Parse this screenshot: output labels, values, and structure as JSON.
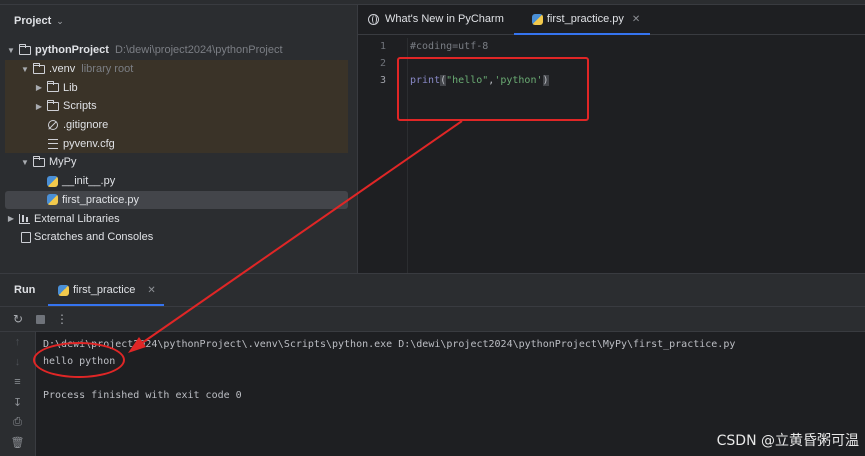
{
  "project_panel": {
    "title": "Project",
    "tree": [
      {
        "label": "pythonProject",
        "hint": "D:\\dewi\\project2024\\pythonProject"
      },
      {
        "label": ".venv",
        "hint": "library root"
      },
      {
        "label": "Lib"
      },
      {
        "label": "Scripts"
      },
      {
        "label": ".gitignore"
      },
      {
        "label": "pyvenv.cfg"
      },
      {
        "label": "MyPy"
      },
      {
        "label": "__init__.py"
      },
      {
        "label": "first_practice.py"
      },
      {
        "label": "External Libraries"
      },
      {
        "label": "Scratches and Consoles"
      }
    ]
  },
  "editor": {
    "tabs": [
      {
        "label": "What's New in PyCharm"
      },
      {
        "label": "first_practice.py"
      }
    ],
    "line_numbers": [
      "1",
      "2",
      "3"
    ],
    "code": {
      "line1": "#coding=utf-8",
      "fn": "print",
      "open": "(",
      "s1": "\"hello\"",
      "comma": ",",
      "s2": "'python'",
      "close": ")"
    }
  },
  "run_panel": {
    "title": "Run",
    "tab_label": "first_practice",
    "console": [
      "D:\\dewi\\project2024\\pythonProject\\.venv\\Scripts\\python.exe D:\\dewi\\project2024\\pythonProject\\MyPy\\first_practice.py",
      "hello python",
      "",
      "Process finished with exit code 0"
    ]
  },
  "annotations": {
    "color": "#e02626"
  },
  "watermark": "CSDN @立黄昏粥可温",
  "colors": {
    "accent": "#3574f0",
    "comment": "#7a7e85",
    "string": "#6aab73",
    "builtin": "#8888c6"
  }
}
